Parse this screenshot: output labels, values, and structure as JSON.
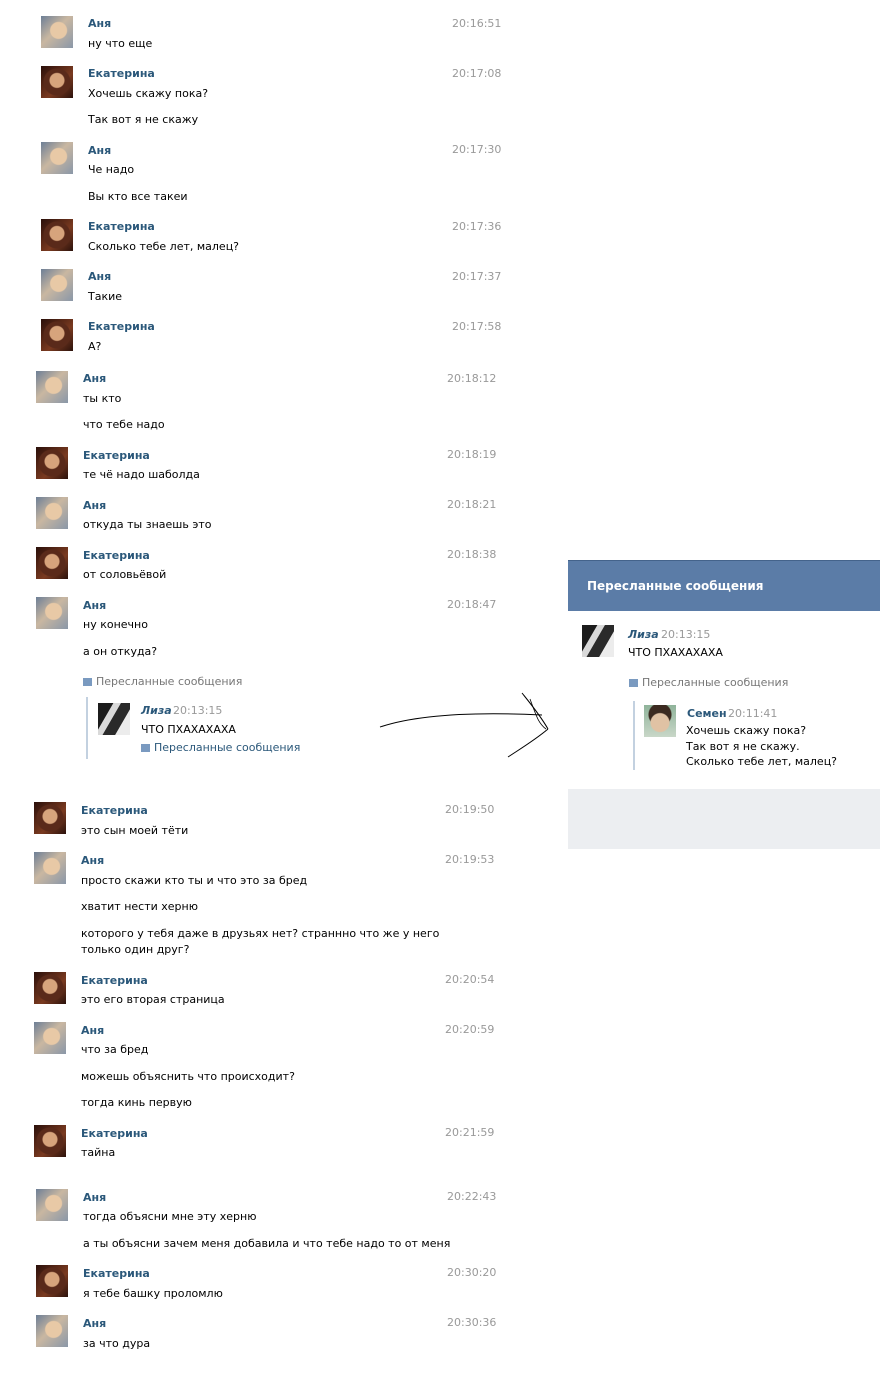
{
  "messages": [
    {
      "author": "Аня",
      "time": "20:16:51",
      "lines": [
        "ну что еще"
      ]
    },
    {
      "author": "Екатерина",
      "time": "20:17:08",
      "lines": [
        "Хочешь скажу пока?",
        "Так вот я не скажу"
      ]
    },
    {
      "author": "Аня",
      "time": "20:17:30",
      "lines": [
        "Че надо",
        "Вы кто все такеи"
      ]
    },
    {
      "author": "Екатерина",
      "time": "20:17:36",
      "lines": [
        "Сколько тебе лет, малец?"
      ]
    },
    {
      "author": "Аня",
      "time": "20:17:37",
      "lines": [
        "Такие"
      ]
    },
    {
      "author": "Екатерина",
      "time": "20:17:58",
      "lines": [
        "А?"
      ]
    },
    {
      "author": "Аня",
      "time": "20:18:12",
      "lines": [
        "ты кто",
        "что тебе надо"
      ]
    },
    {
      "author": "Екатерина",
      "time": "20:18:19",
      "lines": [
        "те чё надо шаболда"
      ]
    },
    {
      "author": "Аня",
      "time": "20:18:21",
      "lines": [
        "откуда ты знаешь это"
      ]
    },
    {
      "author": "Екатерина",
      "time": "20:18:38",
      "lines": [
        "от соловьёвой"
      ]
    },
    {
      "author": "Аня",
      "time": "20:18:47",
      "lines": [
        "ну конечно",
        "а он откуда?"
      ]
    },
    {
      "author": "Екатерина",
      "time": "20:19:50",
      "lines": [
        "это сын моей тёти"
      ]
    },
    {
      "author": "Аня",
      "time": "20:19:53",
      "lines": [
        "просто скажи кто ты и что это за бред",
        "хватит нести херню",
        "которого у тебя даже в друзьях нет? страннно что же у него",
        "только один друг?"
      ]
    },
    {
      "author": "Екатерина",
      "time": "20:20:54",
      "lines": [
        "это его вторая страница"
      ]
    },
    {
      "author": "Аня",
      "time": "20:20:59",
      "lines": [
        "что за бред",
        "можешь объяснить что происходит?",
        "тогда кинь первую"
      ]
    },
    {
      "author": "Екатерина",
      "time": "20:21:59",
      "lines": [
        "тайна"
      ]
    },
    {
      "author": "Аня",
      "time": "20:22:43",
      "lines": [
        "тогда объясни мне эту херню",
        "а ты объясни зачем меня добавила и что тебе надо то от меня"
      ]
    },
    {
      "author": "Екатерина",
      "time": "20:30:20",
      "lines": [
        "я тебе башку проломлю"
      ]
    },
    {
      "author": "Аня",
      "time": "20:30:36",
      "lines": [
        "за что дура"
      ]
    }
  ],
  "inline_forward": {
    "label": "Пересланные сообщения",
    "author": "Лиза",
    "time": "20:13:15",
    "text": "ЧТО ПХАХАХАХА",
    "nested_label": "Пересланные сообщения"
  },
  "popup": {
    "title": "Пересланные сообщения",
    "author": "Лиза",
    "time": "20:13:15",
    "text": "ЧТО ПХАХАХАХА",
    "nested_label": "Пересланные сообщения",
    "nested": {
      "author": "Семен",
      "time": "20:11:41",
      "lines": [
        "Хочешь скажу пока?",
        "Так вот я не скажу.",
        "Сколько тебе лет, малец?"
      ]
    }
  },
  "colors": {
    "name": "#2b587a",
    "time": "#999999",
    "popup_header": "#5b7ca7",
    "popup_footer": "#eceef1"
  }
}
